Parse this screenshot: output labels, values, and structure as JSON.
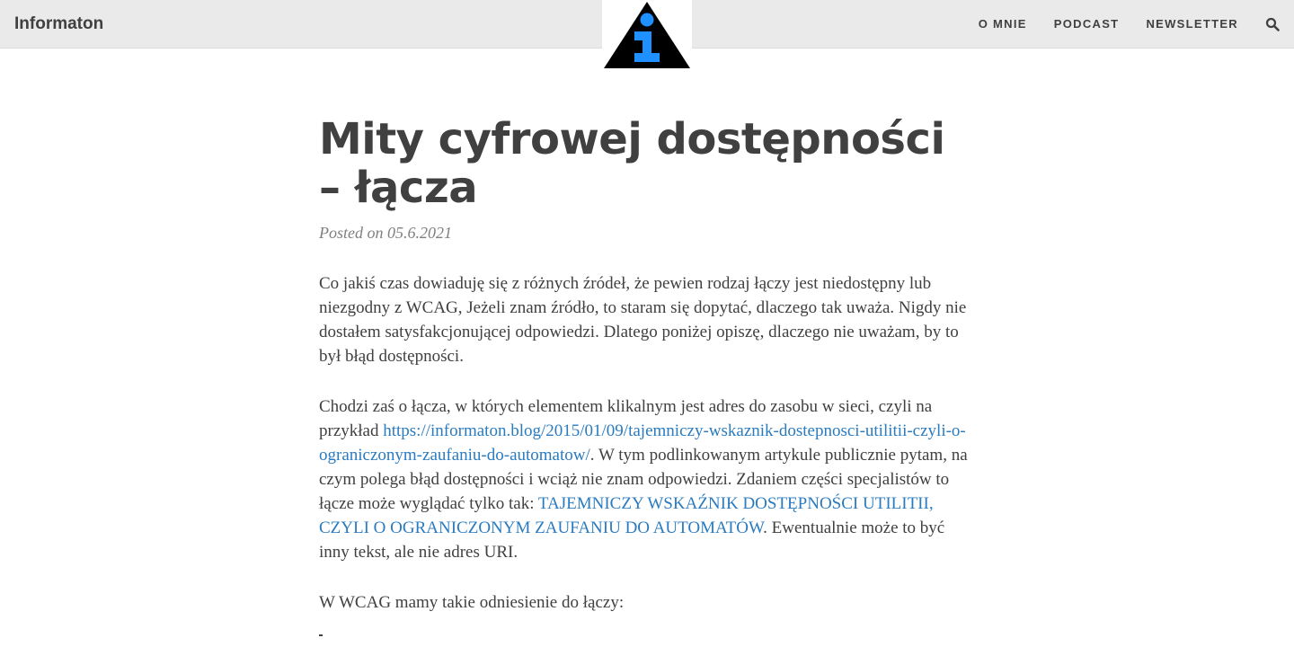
{
  "header": {
    "brand": "Informaton",
    "nav": [
      {
        "label": "O MNIE"
      },
      {
        "label": "PODCAST"
      },
      {
        "label": "NEWSLETTER"
      }
    ],
    "search_icon": "search-icon",
    "logo_icon": "info-triangle-logo"
  },
  "post": {
    "title": "Mity cyfrowej dostępności – łącza",
    "meta": "Posted on 05.6.2021",
    "p1": "Co jakiś czas dowiaduję się z różnych źródeł, że pewien rodzaj łączy jest niedostępny lub niezgodny z WCAG, Jeżeli znam źródło, to staram się dopytać, dlaczego tak uważa. Nigdy nie dostałem satysfakcjonującej odpowiedzi. Dlatego poniżej opiszę, dlaczego nie uważam, by to był błąd dostępności.",
    "p2_before": "Chodzi zaś o łącza, w których elementem klikalnym jest adres do zasobu w sieci, czyli na przykład ",
    "p2_link1": "https://informaton.blog/2015/01/09/tajemniczy-wskaznik-dostepnosci-utilitii-czyli-o-ograniczonym-zaufaniu-do-automatow/",
    "p2_middle": ". W tym podlinkowanym artykule publicznie pytam, na czym polega błąd dostępności i wciąż nie znam odpowiedzi. Zdaniem części specjalistów to łącze może wyglądać tylko tak: ",
    "p2_link2": "TAJEMNICZY WSKAŹNIK DOSTĘPNOŚCI UTILITII, CZYLI O OGRANICZONYM ZAUFANIU DO AUTOMATÓW",
    "p2_after": ". Ewentualnie może to być inny tekst, ale nie adres URI.",
    "p3": "W WCAG mamy takie odniesienie do łączy:"
  },
  "colors": {
    "header_bg": "#eaeaea",
    "text": "#404040",
    "link": "#2a7bbf",
    "meta": "#808080",
    "logo_blue": "#1e90ff"
  }
}
